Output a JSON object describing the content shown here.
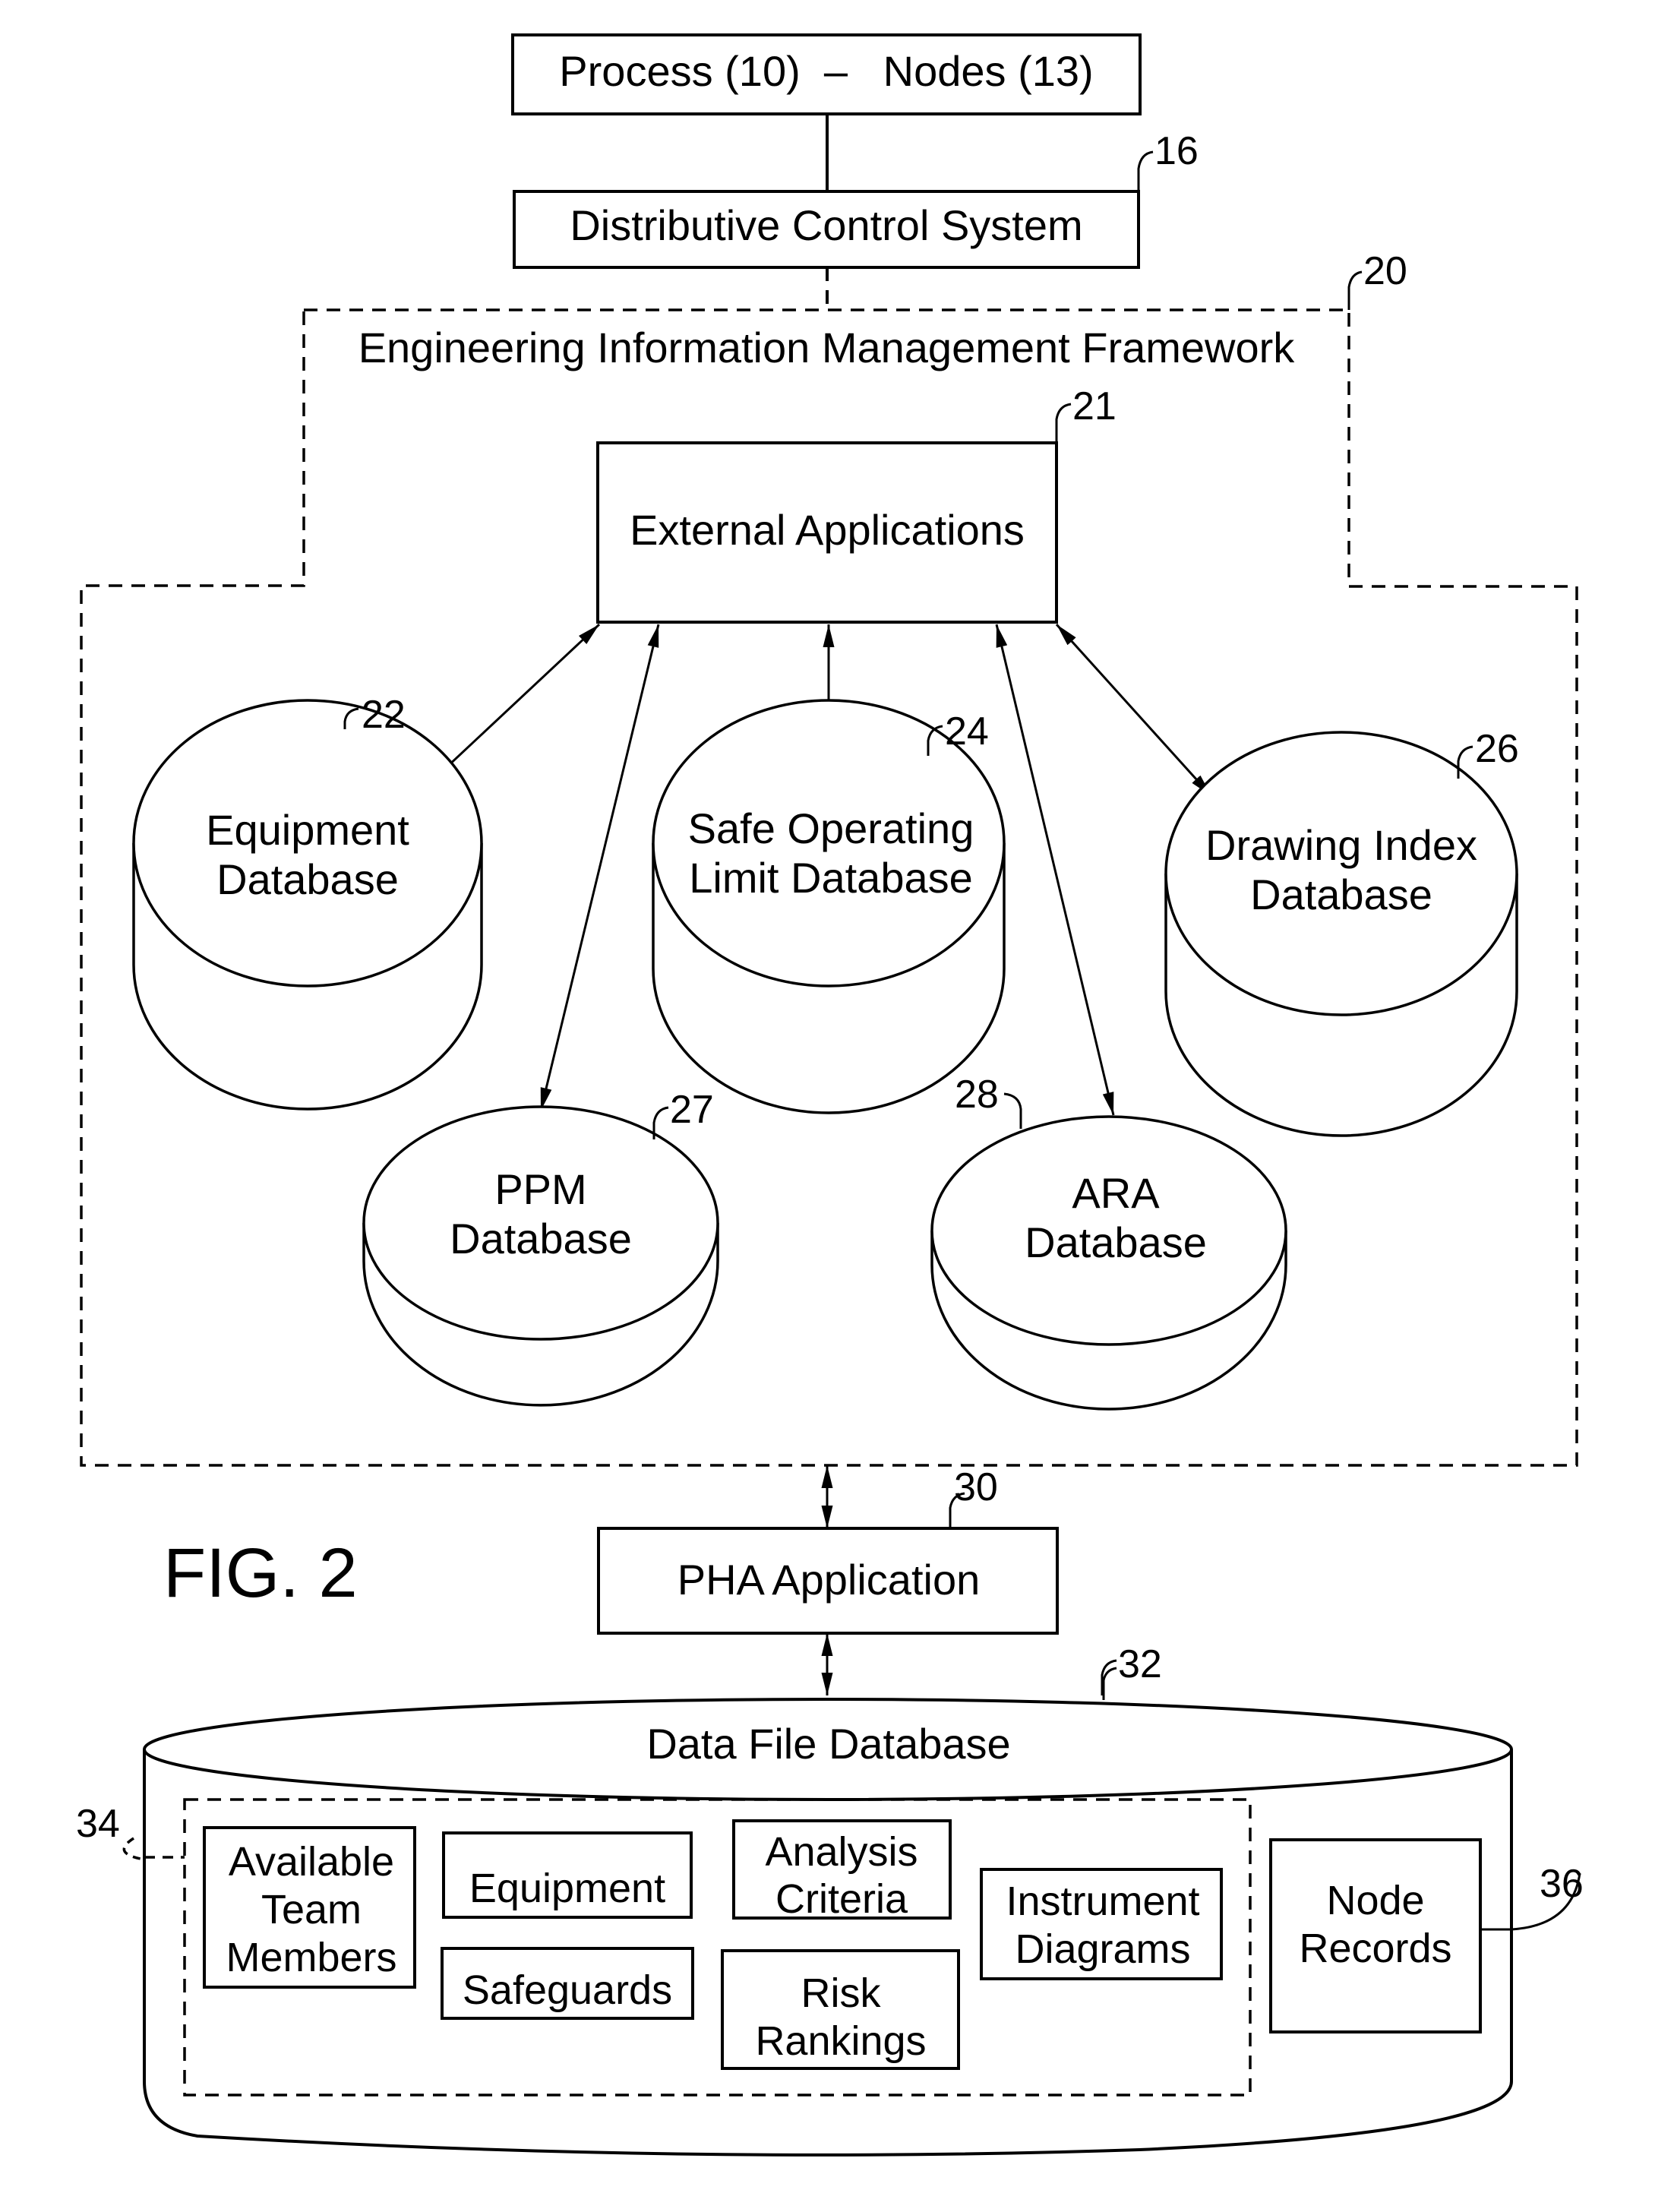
{
  "figure": {
    "title": "FIG. 2"
  },
  "process_box": {
    "label": "Process (10)  –   Nodes (13)"
  },
  "dcs_box": {
    "label": "Distributive Control System",
    "ref": "16"
  },
  "framework": {
    "label": "Engineering Information Management Framework",
    "ref": "20",
    "external_apps": {
      "label": "External Applications",
      "ref": "21"
    },
    "databases": [
      {
        "id": "equipment",
        "lines": [
          "Equipment",
          "Database"
        ],
        "ref": "22"
      },
      {
        "id": "safe-operating-limit",
        "lines": [
          "Safe Operating",
          "Limit Database"
        ],
        "ref": "24"
      },
      {
        "id": "drawing-index",
        "lines": [
          "Drawing Index",
          "Database"
        ],
        "ref": "26"
      },
      {
        "id": "ppm",
        "lines": [
          "PPM",
          "Database"
        ],
        "ref": "27"
      },
      {
        "id": "ara",
        "lines": [
          "ARA",
          "Database"
        ],
        "ref": "28"
      }
    ]
  },
  "pha_app": {
    "label": "PHA Application",
    "ref": "30"
  },
  "data_file_db": {
    "label": "Data File Database",
    "ref": "32",
    "group_ref": "34",
    "items": [
      {
        "id": "available-team-members",
        "lines": [
          "Available",
          "Team",
          "Members"
        ]
      },
      {
        "id": "equipment",
        "lines": [
          "Equipment"
        ]
      },
      {
        "id": "analysis-criteria",
        "lines": [
          "Analysis",
          "Criteria"
        ]
      },
      {
        "id": "instrument-diagrams",
        "lines": [
          "Instrument",
          "Diagrams"
        ]
      },
      {
        "id": "safeguards",
        "lines": [
          "Safeguards"
        ]
      },
      {
        "id": "risk-rankings",
        "lines": [
          "Risk",
          "Rankings"
        ]
      }
    ],
    "node_records": {
      "lines": [
        "Node",
        "Records"
      ],
      "ref": "36"
    }
  }
}
